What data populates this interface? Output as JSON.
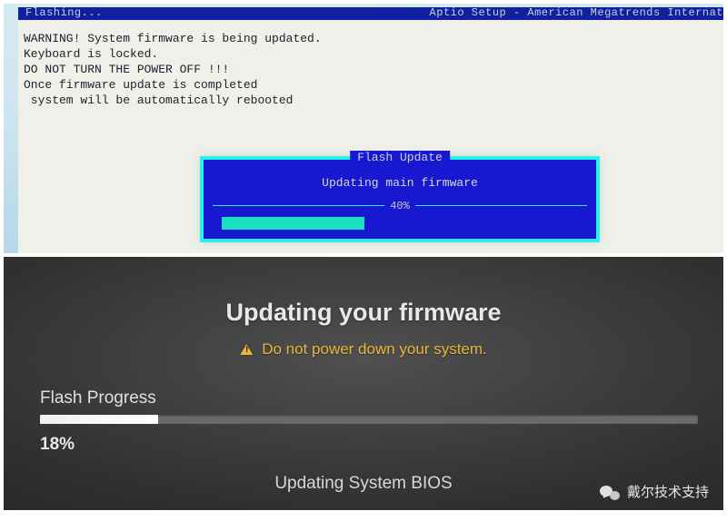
{
  "top": {
    "header_left": "Flashing...",
    "header_right": "Aptio Setup - American Megatrends Internat",
    "warn_line1": "WARNING! System firmware is being updated.",
    "warn_line2": "Keyboard is locked.",
    "warn_line3": "DO NOT TURN THE POWER OFF !!!",
    "warn_line4": "Once firmware update is completed",
    "warn_line5": " system will be automatically rebooted",
    "box_title": "Flash Update",
    "box_msg": "Updating main firmware",
    "box_pct_label": "40%",
    "progress_pct": 40,
    "colors": {
      "bg": "#1818d0",
      "border": "#28f0f0",
      "bar": "#18e0c0"
    }
  },
  "bottom": {
    "title": "Updating your firmware",
    "warning": "Do not power down your system.",
    "progress_label": "Flash Progress",
    "progress_pct_label": "18%",
    "progress_pct": 18,
    "status": "Updating System BIOS",
    "branding": "戴尔技术支持",
    "colors": {
      "warning": "#e8b838",
      "bar_fill": "#ffffff"
    }
  }
}
